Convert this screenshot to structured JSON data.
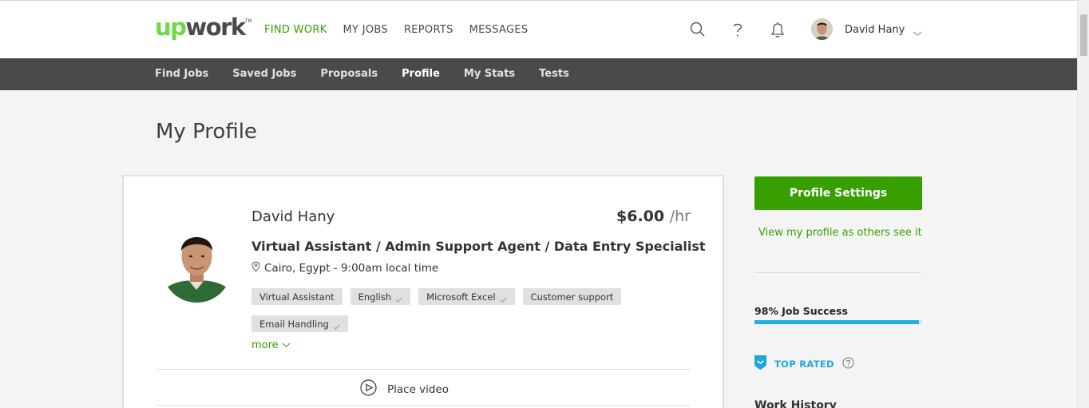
{
  "header": {
    "logo_up": "up",
    "logo_work": "work",
    "logo_tm": "TM",
    "nav": [
      "FIND WORK",
      "MY JOBS",
      "REPORTS",
      "MESSAGES"
    ],
    "user_name": "David Hany",
    "icons": [
      "search-icon",
      "help-icon",
      "bell-icon",
      "chevron-down-icon"
    ]
  },
  "subnav": [
    "Find Jobs",
    "Saved Jobs",
    "Proposals",
    "Profile",
    "My Stats",
    "Tests"
  ],
  "page_title": "My Profile",
  "profile": {
    "name": "David Hany",
    "rate": "$6.00",
    "rate_unit": "/hr",
    "headline": "Virtual Assistant / Admin Support Agent / Data Entry Specialist",
    "location": "Cairo, Egypt - 9:00am local time",
    "skills": [
      {
        "label": "Virtual Assistant",
        "verified": false
      },
      {
        "label": "English",
        "verified": true
      },
      {
        "label": "Microsoft Excel",
        "verified": true
      },
      {
        "label": "Customer support",
        "verified": false
      },
      {
        "label": "Email Handling",
        "verified": true
      }
    ],
    "more_label": "more",
    "video_label": "Place video"
  },
  "sidebar": {
    "settings_button": "Profile Settings",
    "view_link": "View my profile as others see it",
    "job_success_label": "98% Job Success",
    "job_success_value": 98,
    "top_rated_label": "TOP RATED",
    "work_history_label": "Work History"
  },
  "colors": {
    "brand_green": "#37a000",
    "logo_green": "#6fda44",
    "nav_dark": "#4a4a4a",
    "progress_blue": "#1fb0e8"
  }
}
